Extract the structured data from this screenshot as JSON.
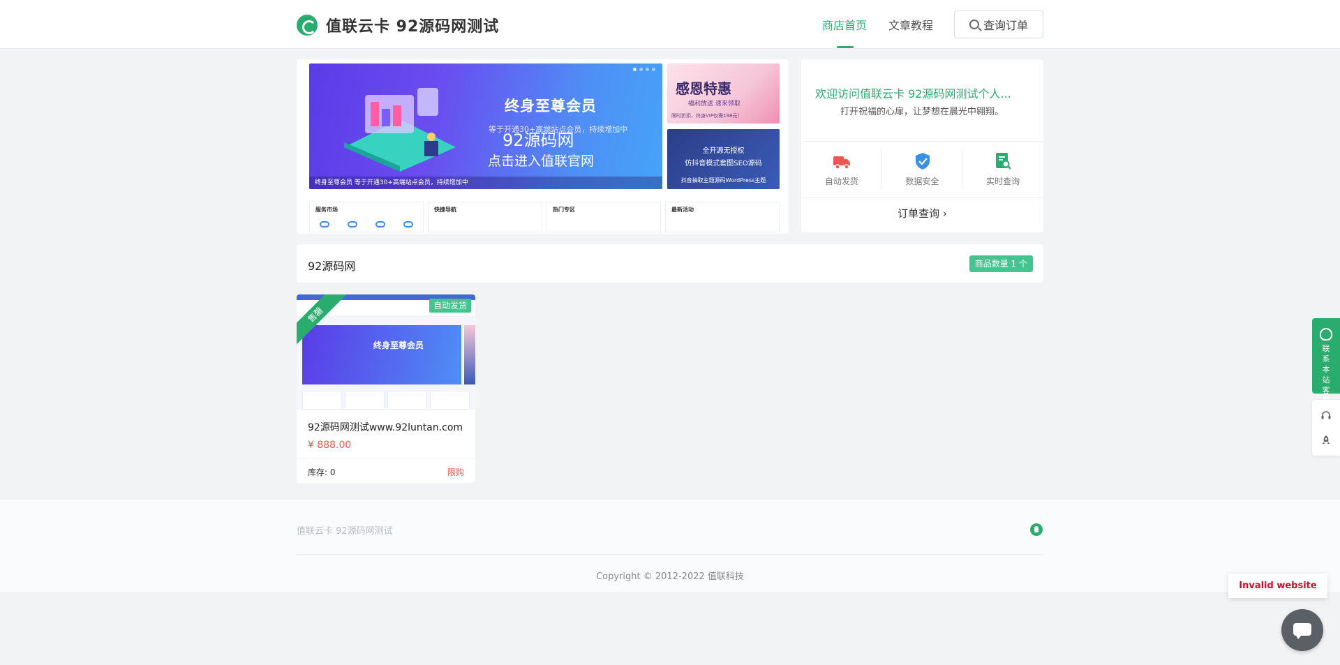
{
  "header": {
    "site_title": "值联云卡 92源码网测试",
    "nav": [
      {
        "label": "商店首页",
        "active": true
      },
      {
        "label": "文章教程",
        "active": false
      }
    ],
    "query_button": "查询订单",
    "accent_color": "#2aac6f"
  },
  "banner": {
    "main": {
      "title": "终身至尊会员",
      "subtitle": "等于开通30+高端站点会员，持续增加中",
      "overlay_line1": "92源码网",
      "overlay_line2": "点击进入值联官网",
      "footer_text": "终身至尊会员  等于开通30+高端站点会员，持续增加中"
    },
    "side1": {
      "title": "感恩特惠",
      "subtitle": "福利放送 速来领取",
      "footer": "限时折扣，终身VIP仅需198元！"
    },
    "side2": {
      "line1": "全开源无授权",
      "line2": "仿抖音模式套图SEO源码",
      "line3": "抖音抽取主题源码WordPress主题"
    },
    "tiles": [
      {
        "title": "服务市场"
      },
      {
        "title": "快捷导航"
      },
      {
        "title": "热门专区"
      },
      {
        "title": "最新活动"
      }
    ]
  },
  "welcome": {
    "title": "欢迎访问值联云卡 92源码网测试个人...",
    "subtitle": "打开祝福的心扉，让梦想在晨光中翱翔。",
    "features": [
      {
        "label": "自动发货",
        "icon": "truck-icon",
        "color": "#f0564d"
      },
      {
        "label": "数据安全",
        "icon": "shield-icon",
        "color": "#3a8ee6"
      },
      {
        "label": "实时查询",
        "icon": "search-doc-icon",
        "color": "#2aac6f"
      }
    ],
    "order_link": "订单查询 ›"
  },
  "category": {
    "title": "92源码网",
    "count_badge": "商品数量 1 个"
  },
  "products": [
    {
      "name": "92源码网测试www.92luntan.com",
      "price": "¥ 888.00",
      "stock": "库存: 0",
      "limit": "限购",
      "ribbon": "售罄",
      "auto_tag": "自动发货",
      "image_banner_text": "终身至尊会员"
    }
  ],
  "footer": {
    "brand": "值联云卡 92源码网测试",
    "copyright": "Copyright © 2012-2022 值联科技"
  },
  "floating": {
    "contact_label": "联系本站客服",
    "invalid_badge": "Invalid website"
  }
}
